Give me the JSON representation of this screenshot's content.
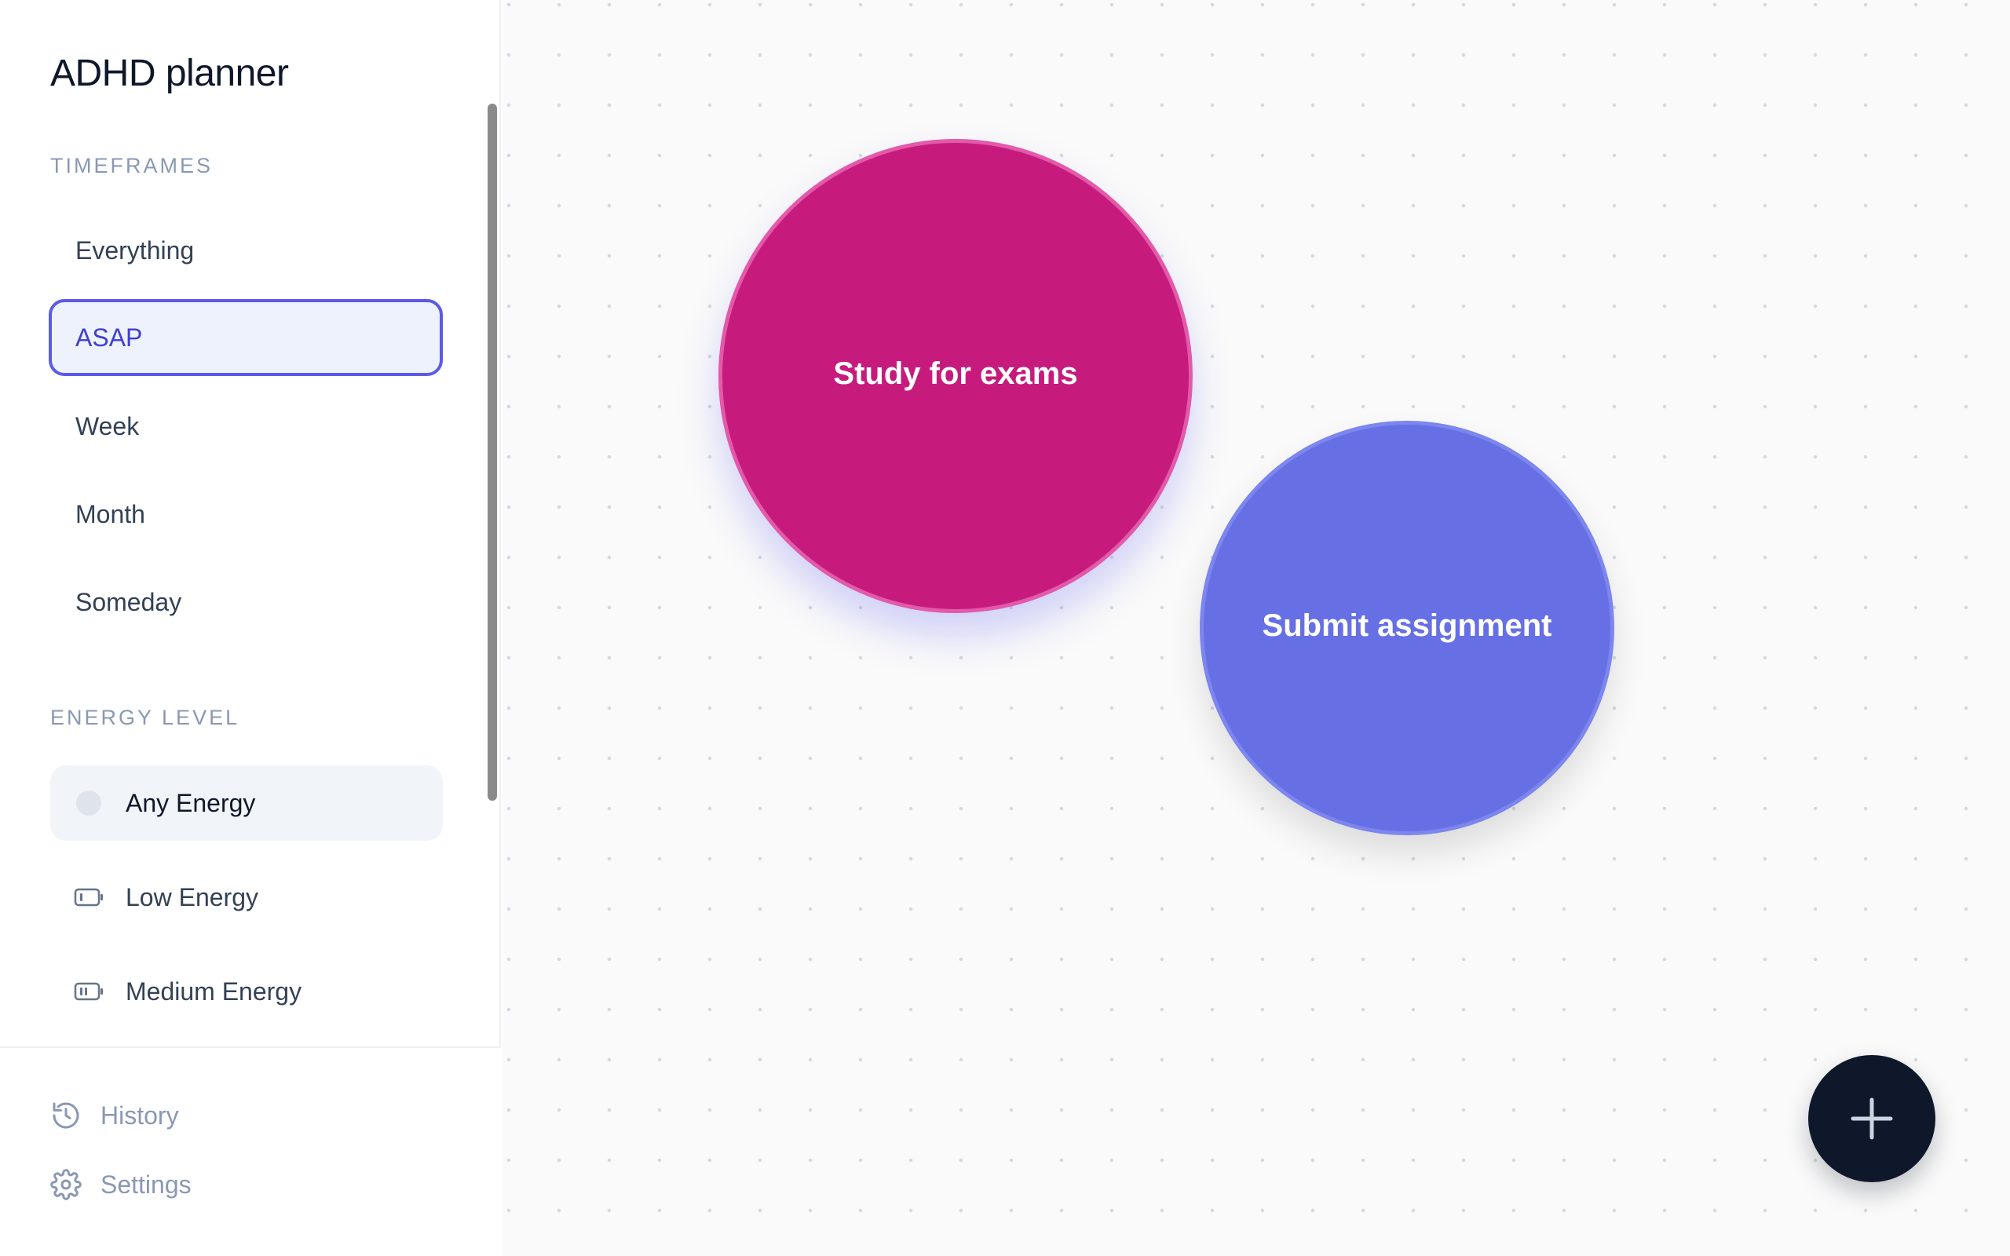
{
  "app": {
    "title_light": "ADHD",
    "title_bold": "planner"
  },
  "timeframes": {
    "label": "TIMEFRAMES",
    "items": [
      {
        "label": "Everything",
        "active": false
      },
      {
        "label": "ASAP",
        "active": true
      },
      {
        "label": "Week",
        "active": false
      },
      {
        "label": "Month",
        "active": false
      },
      {
        "label": "Someday",
        "active": false
      }
    ]
  },
  "energy": {
    "label": "ENERGY LEVEL",
    "items": [
      {
        "label": "Any Energy",
        "icon": "dot-icon",
        "active": true
      },
      {
        "label": "Low Energy",
        "icon": "battery-low-icon",
        "active": false
      },
      {
        "label": "Medium Energy",
        "icon": "battery-medium-icon",
        "active": false
      }
    ]
  },
  "footer": {
    "history": {
      "label": "History",
      "icon": "history-icon"
    },
    "settings": {
      "label": "Settings",
      "icon": "gear-icon"
    }
  },
  "tasks": [
    {
      "label": "Study for exams",
      "color": "#c61b7d"
    },
    {
      "label": "Submit assignment",
      "color": "#6670e4"
    }
  ],
  "fab": {
    "icon": "plus-icon"
  },
  "colors": {
    "accent": "#5b5be8",
    "fab": "#0f172a",
    "muted": "#8a98b4"
  }
}
